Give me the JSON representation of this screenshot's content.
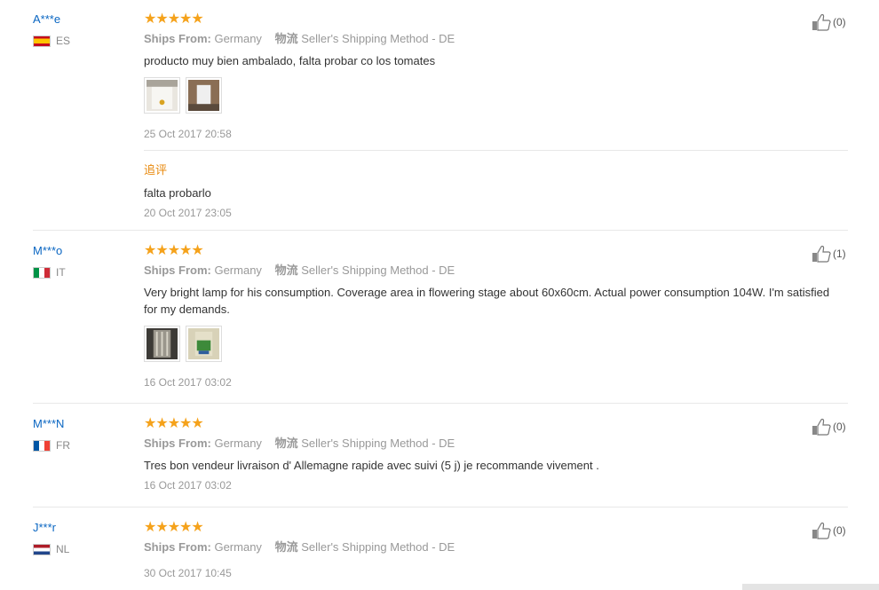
{
  "reviews": [
    {
      "user": "A***e",
      "country": "ES",
      "stars": "★★★★★",
      "ships_label": "Ships From:",
      "ships_from": "Germany",
      "logistics_label": "物流",
      "shipping_method": "Seller's Shipping Method - DE",
      "text": "producto muy bien ambalado, falta probar co los tomates",
      "date": "25 Oct 2017 20:58",
      "likes": "(0)",
      "additional": {
        "label": "追评",
        "text": "falta probarlo",
        "date": "20 Oct 2017 23:05"
      }
    },
    {
      "user": "M***o",
      "country": "IT",
      "stars": "★★★★★",
      "ships_label": "Ships From:",
      "ships_from": "Germany",
      "logistics_label": "物流",
      "shipping_method": "Seller's Shipping Method - DE",
      "text": "Very bright lamp for his consumption. Coverage area in flowering stage about 60x60cm. Actual power consumption 104W. I'm satisfied for my demands.",
      "date": "16 Oct 2017 03:02",
      "likes": "(1)"
    },
    {
      "user": "M***N",
      "country": "FR",
      "stars": "★★★★★",
      "ships_label": "Ships From:",
      "ships_from": "Germany",
      "logistics_label": "物流",
      "shipping_method": "Seller's Shipping Method - DE",
      "text": "Tres bon vendeur livraison d' Allemagne rapide avec suivi (5 j) je recommande vivement .",
      "date": "16 Oct 2017 03:02",
      "likes": "(0)"
    },
    {
      "user": "J***r",
      "country": "NL",
      "stars": "★★★★★",
      "ships_label": "Ships From:",
      "ships_from": "Germany",
      "logistics_label": "物流",
      "shipping_method": "Seller's Shipping Method - DE",
      "date": "30 Oct 2017 10:45",
      "likes": "(0)"
    }
  ],
  "colors": {
    "username": "#0a66c2",
    "stars": "#f5a21b",
    "additional_label": "#e8890c",
    "muted": "#999999"
  },
  "icons": {
    "like": "thumbs-up-icon",
    "flag_es": "flag-spain-icon",
    "flag_it": "flag-italy-icon",
    "flag_fr": "flag-france-icon",
    "flag_nl": "flag-netherlands-icon"
  }
}
